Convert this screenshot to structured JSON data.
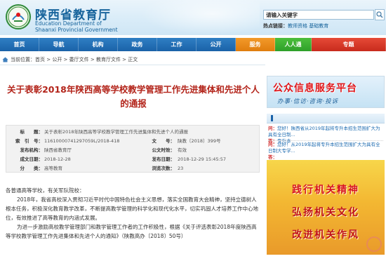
{
  "header": {
    "site_name_cn": "陕西省教育厅",
    "site_name_en_line1": "Education Department of",
    "site_name_en_line2": "Shaanxi Provincial Government",
    "search_placeholder": "请输入关键字",
    "hot_label": "热点链接：",
    "hot_links": "教师资格  基础教育"
  },
  "nav": {
    "items": [
      {
        "label": "首页",
        "style": "blue"
      },
      {
        "label": "导航",
        "style": "blue"
      },
      {
        "label": "机构",
        "style": "blue"
      },
      {
        "label": "政务",
        "style": "blue"
      },
      {
        "label": "工作",
        "style": "blue"
      },
      {
        "label": "公开",
        "style": "blue"
      },
      {
        "label": "服务",
        "style": "orange"
      },
      {
        "label": "人人通",
        "style": "green"
      },
      {
        "label": "专题",
        "style": "red"
      }
    ]
  },
  "breadcrumb": "当前位置：首页 > 公开 > 委厅文件 > 教育厅文件 > 正文",
  "article": {
    "title": "关于表彰2018年陕西高等学校教学管理工作先进集体和先进个人的通报",
    "meta": [
      {
        "key": "标　　题：",
        "value": "关于表彰2018年陕西高等学校教学管理工作先进集体和先进个人的通报"
      },
      {
        "key": "索　引　号：",
        "value": "11610000741297059L/2018-418",
        "key2": "文　　号：",
        "value2": "陕教〔2018〕399号"
      },
      {
        "key": "发布机构：",
        "value": "陕西省教育厅",
        "key2": "公文时效：",
        "value2": "有效"
      },
      {
        "key": "成文日期：",
        "value": "2018-12-28",
        "key2": "发布日期：",
        "value2": "2018-12-29 15:45:57"
      },
      {
        "key": "分　　类：",
        "value": "高等教育",
        "key2": "浏览次数：",
        "value2": "23"
      }
    ],
    "paragraphs": [
      "各普通高等学校，有关军队院校：",
      "2018年，我省高校深入贯彻习近平时代中国特色社会主义思想，落实全国教育大会精神，坚持立德树人根本任务，积极深化教育教学改革，不断提高教学管理的科学化和现代化水平，切实巩固人才培养工作中心地位，有效推进了高等教育的内涵式发展。",
      "为进一步激励高校教学管理部门和教学管理工作者的工作积极性，根据《关于评选表彰2018年度陕西高等学校教学管理工作先进集体和先进个人的通知》（陕教高办〔2018〕50号）"
    ]
  },
  "sidebar": {
    "banner_title": "公众信息服务平台",
    "banner_subtitle": "办事·信访·咨询·投诉",
    "qa": [
      {
        "q_label": "问：",
        "question": "您好！陕西省从2019年起将专升本招生范围扩大为具有全日制...",
        "a_label": "答：",
        "answer": "专升本"
      },
      {
        "q_label": "问：",
        "question": "您好！从2019年起将专升本招生范围扩大为具有全日制大专学...",
        "a_label": "答：",
        "answer": ""
      }
    ],
    "slogans": [
      "践行机关精神",
      "弘扬机关文化",
      "改进机关作风"
    ]
  },
  "colors": {
    "nav_blue": "#1a62a8",
    "title_red": "#b3241a",
    "link_blue": "#1d6bb0"
  }
}
